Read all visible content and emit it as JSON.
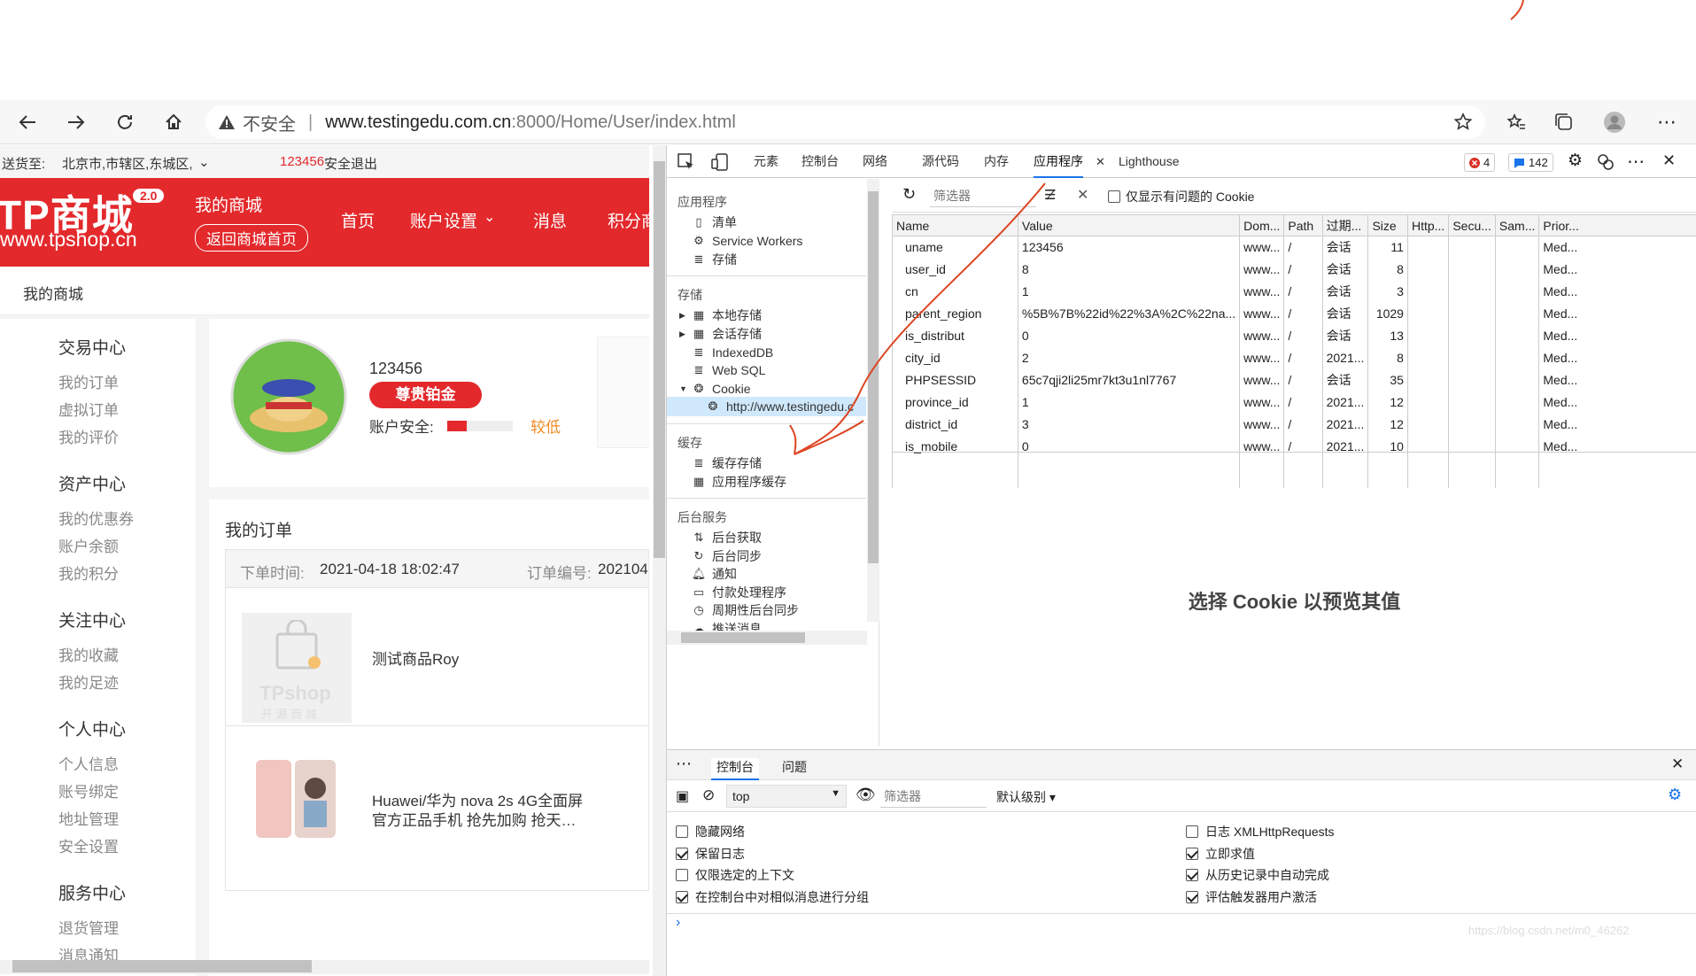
{
  "browser": {
    "security_label": "不安全",
    "url_host": "www.testingedu.com.cn",
    "url_path": ":8000/Home/User/index.html"
  },
  "site": {
    "ship_to_label": "送货至:",
    "ship_to_value": "北京市,市辖区,东城区,",
    "user": "123456",
    "logout": "安全退出",
    "logo_text": "TP商城",
    "logo_version": "2.0",
    "logo_url": "www.tpshop.cn",
    "my_mall": "我的商城",
    "back_home": "返回商城首页",
    "nav": [
      "首页",
      "账户设置",
      "消息",
      "积分商"
    ],
    "breadcrumb": "我的商城",
    "menu": [
      {
        "title": "交易中心",
        "items": [
          "我的订单",
          "虚拟订单",
          "我的评价"
        ]
      },
      {
        "title": "资产中心",
        "items": [
          "我的优惠券",
          "账户余额",
          "我的积分"
        ]
      },
      {
        "title": "关注中心",
        "items": [
          "我的收藏",
          "我的足迹"
        ]
      },
      {
        "title": "个人中心",
        "items": [
          "个人信息",
          "账号绑定",
          "地址管理",
          "安全设置"
        ]
      },
      {
        "title": "服务中心",
        "items": [
          "退货管理",
          "消息通知"
        ]
      }
    ],
    "profile": {
      "name": "123456",
      "level": "尊贵铂金",
      "security_label": "账户安全:",
      "security_level": "较低"
    },
    "orders": {
      "title": "我的订单",
      "time_label": "下单时间:",
      "time_value": "2021-04-18 18:02:47",
      "no_label": "订单编号:",
      "no_value": "202104",
      "item1": "测试商品Roy",
      "item1_thumb": "TPshop",
      "item1_thumb_sub": "开 源 商 城",
      "item2_line1": "Huawei/华为 nova 2s 4G全面屏",
      "item2_line2": "官方正品手机 抢先加购 抢天…"
    }
  },
  "devtools": {
    "tabs": [
      "元素",
      "控制台",
      "网络",
      "源代码",
      "内存",
      "应用程序",
      "Lighthouse"
    ],
    "errors": "4",
    "messages": "142",
    "nav": {
      "app_header": "应用程序",
      "app_items": [
        "清单",
        "Service Workers",
        "存储"
      ],
      "storage_header": "存储",
      "storage_items": [
        "本地存储",
        "会话存储",
        "IndexedDB",
        "Web SQL",
        "Cookie"
      ],
      "cookie_child": "http://www.testingedu.c",
      "cache_header": "缓存",
      "cache_items": [
        "缓存存储",
        "应用程序缓存"
      ],
      "bg_header": "后台服务",
      "bg_items": [
        "后台获取",
        "后台同步",
        "通知",
        "付款处理程序",
        "周期性后台同步",
        "推送消息"
      ]
    },
    "cookie_filter_placeholder": "筛选器",
    "only_issues": "仅显示有问题的 Cookie",
    "columns": [
      "Name",
      "Value",
      "Dom...",
      "Path",
      "过期...",
      "Size",
      "Http...",
      "Secu...",
      "Sam...",
      "Prior..."
    ],
    "rows": [
      [
        "uname",
        "123456",
        "www...",
        "/",
        "会话",
        "11",
        "",
        "",
        "",
        "Med..."
      ],
      [
        "user_id",
        "8",
        "www...",
        "/",
        "会话",
        "8",
        "",
        "",
        "",
        "Med..."
      ],
      [
        "cn",
        "1",
        "www...",
        "/",
        "会话",
        "3",
        "",
        "",
        "",
        "Med..."
      ],
      [
        "parent_region",
        "%5B%7B%22id%22%3A%2C%22na...",
        "www...",
        "/",
        "会话",
        "1029",
        "",
        "",
        "",
        "Med..."
      ],
      [
        "is_distribut",
        "0",
        "www...",
        "/",
        "会话",
        "13",
        "",
        "",
        "",
        "Med..."
      ],
      [
        "city_id",
        "2",
        "www...",
        "/",
        "2021...",
        "8",
        "",
        "",
        "",
        "Med..."
      ],
      [
        "PHPSESSID",
        "65c7qji2li25mr7kt3u1nl7767",
        "www...",
        "/",
        "会话",
        "35",
        "",
        "",
        "",
        "Med..."
      ],
      [
        "province_id",
        "1",
        "www...",
        "/",
        "2021...",
        "12",
        "",
        "",
        "",
        "Med..."
      ],
      [
        "district_id",
        "3",
        "www...",
        "/",
        "2021...",
        "12",
        "",
        "",
        "",
        "Med..."
      ],
      [
        "is_mobile",
        "0",
        "www...",
        "/",
        "2021...",
        "10",
        "",
        "",
        "",
        "Med..."
      ]
    ],
    "preview_hint": "选择 Cookie 以预览其值",
    "console": {
      "tabs": [
        "控制台",
        "问题"
      ],
      "context": "top",
      "filter_placeholder": "筛选器",
      "level": "默认级别",
      "options_left": [
        {
          "label": "隐藏网络",
          "checked": false
        },
        {
          "label": "保留日志",
          "checked": true
        },
        {
          "label": "仅限选定的上下文",
          "checked": false
        },
        {
          "label": "在控制台中对相似消息进行分组",
          "checked": true
        }
      ],
      "options_right": [
        {
          "label": "日志 XMLHttpRequests",
          "checked": false
        },
        {
          "label": "立即求值",
          "checked": true
        },
        {
          "label": "从历史记录中自动完成",
          "checked": true
        },
        {
          "label": "评估触发器用户激活",
          "checked": true
        }
      ],
      "watermark": "https://blog.csdn.net/m0_46262"
    }
  },
  "colors": {
    "brand_red": "#e3292c",
    "devtools_blue": "#1a73e8"
  }
}
